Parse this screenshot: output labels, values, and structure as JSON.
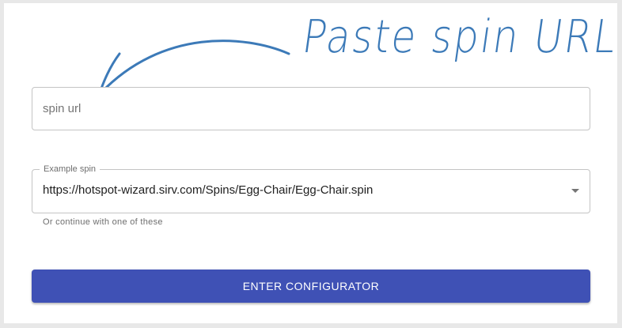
{
  "hint": {
    "text": "Paste spin URL",
    "color": "#3c7ab8",
    "icon": "curved-arrow-icon"
  },
  "spin_url": {
    "value": "",
    "placeholder": "spin url"
  },
  "example_select": {
    "legend": "Example spin",
    "selected": "https://hotspot-wizard.sirv.com/Spins/Egg-Chair/Egg-Chair.spin",
    "icon": "dropdown-caret-icon",
    "helper": "Or continue with one of these"
  },
  "enter_button": {
    "label": "ENTER CONFIGURATOR",
    "color": "#3f51b5"
  }
}
